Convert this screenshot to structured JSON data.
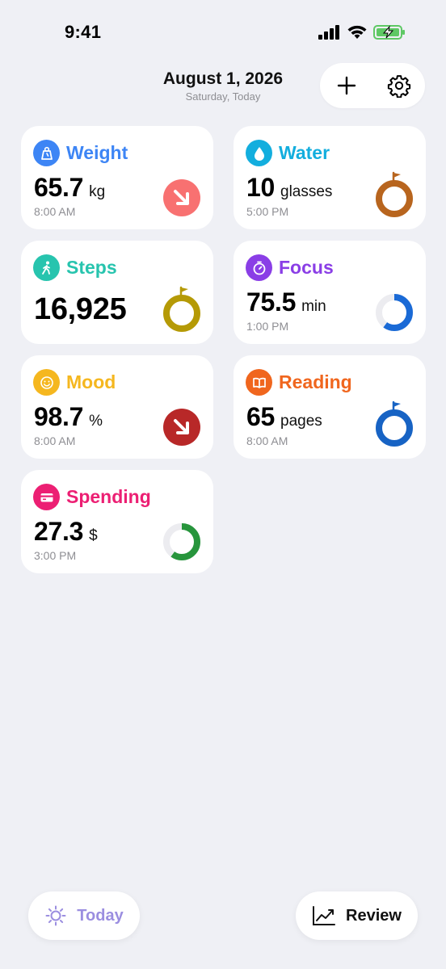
{
  "status_bar": {
    "time": "9:41"
  },
  "header": {
    "title": "August 1, 2026",
    "subtitle": "Saturday, Today"
  },
  "cards": {
    "weight": {
      "title": "Weight",
      "value": "65.7",
      "unit": "kg",
      "time": "8:00 AM",
      "color": "#3d85f5",
      "widget": "trend-down-arrow",
      "widget_color": "#f87171"
    },
    "water": {
      "title": "Water",
      "value": "10",
      "unit": "glasses",
      "time": "5:00 PM",
      "color": "#13aede",
      "widget": "goal-ring-flag",
      "widget_color": "#b8651e"
    },
    "steps": {
      "title": "Steps",
      "value": "16,925",
      "unit": "",
      "time": "",
      "color": "#27c4ae",
      "widget": "goal-ring-flag",
      "widget_color": "#b59a06"
    },
    "focus": {
      "title": "Focus",
      "value": "75.5",
      "unit": "min",
      "time": "1:00 PM",
      "color": "#8a3ee6",
      "widget": "progress-ring",
      "widget_color": "#1a6ad6",
      "progress": 0.6
    },
    "mood": {
      "title": "Mood",
      "value": "98.7",
      "unit": "%",
      "time": "8:00 AM",
      "color": "#f5b71f",
      "widget": "trend-down-arrow",
      "widget_color": "#b82828"
    },
    "reading": {
      "title": "Reading",
      "value": "65",
      "unit": "pages",
      "time": "8:00 AM",
      "color": "#f0661e",
      "widget": "goal-ring-flag",
      "widget_color": "#1763c4"
    },
    "spending": {
      "title": "Spending",
      "value": "27.3",
      "unit": "$",
      "time": "3:00 PM",
      "color": "#ec1f73",
      "widget": "progress-ring",
      "widget_color": "#27953c",
      "progress": 0.6
    }
  },
  "bottom_nav": {
    "today_label": "Today",
    "today_color": "#9b8ee0",
    "review_label": "Review"
  }
}
